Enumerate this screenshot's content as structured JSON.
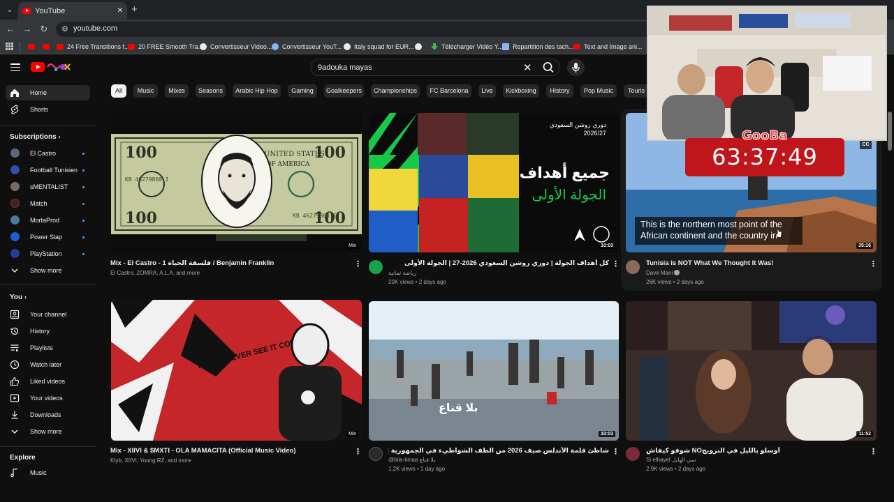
{
  "browser": {
    "tab_title": "YouTube",
    "url": "youtube.com",
    "bookmarks": [
      {
        "label": "",
        "icon": "youtube-icon"
      },
      {
        "label": "",
        "icon": "youtube-icon"
      },
      {
        "label": "24 Free Transitions f...",
        "icon": "youtube-icon"
      },
      {
        "label": "20 FREE Smooth Tra...",
        "icon": "youtube-icon"
      },
      {
        "label": "Convertisseur Video...",
        "icon": "google-icon"
      },
      {
        "label": "Convertisseur YouT...",
        "icon": "globe-icon"
      },
      {
        "label": "Italy squad for EUR...",
        "icon": "globe-icon"
      },
      {
        "label": "",
        "icon": "globe-icon"
      },
      {
        "label": "Télécharger Vidéo Y...",
        "icon": "download-icon"
      },
      {
        "label": "Repartition des tach...",
        "icon": "doc-icon"
      },
      {
        "label": "Text and Image ani...",
        "icon": "youtube-icon"
      }
    ]
  },
  "search": {
    "query": "9adouka mayas"
  },
  "sidebar": {
    "main": [
      {
        "label": "Home",
        "icon": "home-icon"
      },
      {
        "label": "Shorts",
        "icon": "shorts-icon"
      }
    ],
    "subscriptions_heading": "Subscriptions",
    "subscriptions": [
      {
        "label": "El Castro",
        "color": "#5a6a7a"
      },
      {
        "label": "Football Tunisien",
        "color": "#2f4fa8"
      },
      {
        "label": "sMENTALIST",
        "color": "#7a6a62"
      },
      {
        "label": "Match",
        "color": "#2a2a2a"
      },
      {
        "label": "MortaProd",
        "color": "#4c7a9a"
      },
      {
        "label": "Power Slap",
        "color": "#1d5fd6"
      },
      {
        "label": "PlayStation",
        "color": "#1f3f9a"
      }
    ],
    "show_more": "Show more",
    "you_heading": "You",
    "you": [
      {
        "label": "Your channel",
        "icon": "channel-icon"
      },
      {
        "label": "History",
        "icon": "history-icon"
      },
      {
        "label": "Playlists",
        "icon": "playlists-icon"
      },
      {
        "label": "Watch later",
        "icon": "watch-later-icon"
      },
      {
        "label": "Liked videos",
        "icon": "like-icon"
      },
      {
        "label": "Your videos",
        "icon": "your-videos-icon"
      },
      {
        "label": "Downloads",
        "icon": "download-icon"
      }
    ],
    "show_more_2": "Show more",
    "explore_heading": "Explore",
    "explore": [
      {
        "label": "Music",
        "icon": "music-icon"
      }
    ]
  },
  "chips": [
    "All",
    "Music",
    "Mixes",
    "Seasons",
    "Arabic Hip Hop",
    "Gaming",
    "Goalkeepers",
    "Championships",
    "FC Barcelona",
    "Live",
    "Kickboxing",
    "History",
    "Pop Music",
    "Touris"
  ],
  "videos": [
    {
      "title": "Mix - El Castro -  1  فلسفة الحياة / Benjamin Franklin",
      "meta1": "El Castro, ZOMRA, A.L.A, and more",
      "meta2": "",
      "badge": "Mix",
      "thumb_text": ""
    },
    {
      "title": "كل أهداف الجولة | دوري روشن السعودي 2026-27 | الجولة الأولى",
      "meta1": "رياضة ثمانية",
      "meta2": "20K views • 2 days ago",
      "badge": "10:03",
      "thumb_text": "جميع أهداف",
      "thumb_text2": "الجولة الأولى",
      "thumb_text3": "دوري روشن السعودي",
      "thumb_text4": "2026/27"
    },
    {
      "title": "Tunisia is NOT What We Thought It Was!",
      "meta1": "Dave Mani",
      "meta2": "26K views • 2 days ago",
      "badge": "35:16",
      "thumb_text": ""
    },
    {
      "title": "Mix - XIIVI & $MXTI - OLA MAMACITA (Official Music Video)",
      "meta1": "Ktyb, XIIVI, Young RZ, and more",
      "meta2": "",
      "badge": "Mix",
      "thumb_text": "YOU'LL NEVER SEE IT COMING"
    },
    {
      "title": "شاطئ قلمة الأندلس صيف 2026 من الطف الشواطيء في الجمهورية التونسية",
      "meta1": "@bila-kinaa بلا قناع",
      "meta2": "1.2K views • 1 day ago",
      "badge": "10:03",
      "thumb_text": "بلا قناع"
    },
    {
      "title": "شوفو كيفاش NOأوسلو بالليل في النرويج",
      "meta1": "Si elhayel سي الهايل",
      "meta2": "2.9K views • 2 days ago",
      "badge": "11:52",
      "thumb_text": ""
    }
  ],
  "overlay": {
    "timer": "63:37:49",
    "brand": "GooBa",
    "caption_line1": "This is the northern most point of the",
    "caption_line2": "African continent and the country in",
    "cc_label": "CC"
  }
}
